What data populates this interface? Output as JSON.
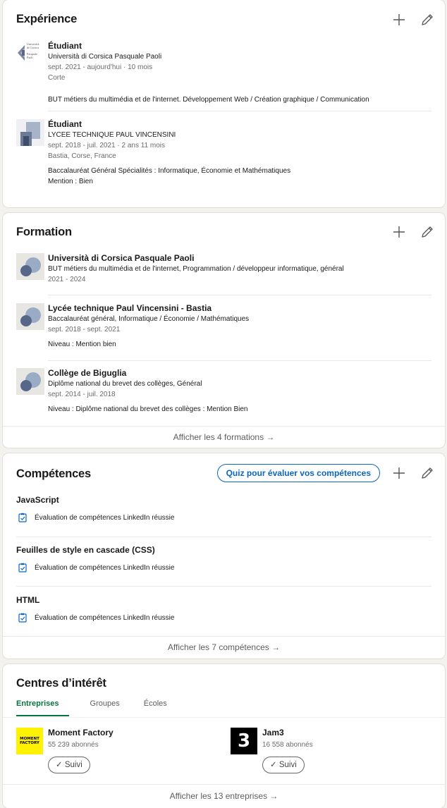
{
  "experience": {
    "title": "Expérience",
    "items": [
      {
        "role": "Étudiant",
        "org": "Università di Corsica Pasquale Paoli",
        "dates": "sept. 2021 - aujourd'hui · 10 mois",
        "location": "Corte",
        "description": "BUT métiers du multimédia et de l'internet. Développement Web / Création graphique / Communication",
        "logo_text": [
          "Università",
          "di Corsica",
          "Pasquale",
          "Paoli"
        ]
      },
      {
        "role": "Étudiant",
        "org": "LYCEE TECHNIQUE PAUL VINCENSINI",
        "dates": "sept. 2018 - juil. 2021 · 2 ans 11 mois",
        "location": "Bastia, Corse, France",
        "description": "Baccalauréat Général Spécialités : Informatique, Économie et Mathématiques",
        "description2": "Mention : Bien"
      }
    ]
  },
  "education": {
    "title": "Formation",
    "items": [
      {
        "school": "Università di Corsica Pasquale Paoli",
        "degree": "BUT métiers du multimédia et de l'internet, Programmation / développeur informatique, général",
        "dates": "2021 - 2024"
      },
      {
        "school": "Lycée technique Paul Vincensini - Bastia",
        "degree": "Baccalauréat général, Informatique / Économie / Mathématiques",
        "dates": "sept. 2018 - sept. 2021",
        "grade": "Niveau : Mention bien"
      },
      {
        "school": "Collège de Biguglia",
        "degree": "Diplôme national du brevet des collèges, Général",
        "dates": "sept. 2014 - juil. 2018",
        "grade": "Niveau : Diplôme national du brevet des collèges : Mention Bien"
      }
    ],
    "show_all": "Afficher les 4 formations →"
  },
  "skills": {
    "title": "Compétences",
    "quiz_label": "Quiz pour évaluer vos compétences",
    "items": [
      {
        "name": "JavaScript",
        "badge": "Évaluation de compétences LinkedIn réussie"
      },
      {
        "name": "Feuilles de style en cascade (CSS)",
        "badge": "Évaluation de compétences LinkedIn réussie"
      },
      {
        "name": "HTML",
        "badge": "Évaluation de compétences LinkedIn réussie"
      }
    ],
    "show_all": "Afficher les 7 compétences →"
  },
  "interests": {
    "title": "Centres d’intérêt",
    "tabs": [
      "Entreprises",
      "Groupes",
      "Écoles"
    ],
    "active_tab": "Entreprises",
    "companies": [
      {
        "name": "Moment Factory",
        "followers": "55 239 abonnés",
        "button": "✓ Suivi",
        "logo_text": [
          "MOMENT",
          "FACTORY"
        ]
      },
      {
        "name": "Jam3",
        "followers": "16 558 abonnés",
        "button": "✓ Suivi",
        "logo_text": "3"
      }
    ],
    "show_all": "Afficher les 13 entreprises →"
  },
  "colors": {
    "link_blue": "#0a66c2",
    "active_green": "#057642",
    "page_bg": "#f3f2ef",
    "moment_factory_yellow": "#fff200"
  },
  "icons": [
    "plus-icon",
    "pencil-icon",
    "clipboard-check-icon",
    "school-placeholder-icon",
    "company-placeholder-icon"
  ]
}
